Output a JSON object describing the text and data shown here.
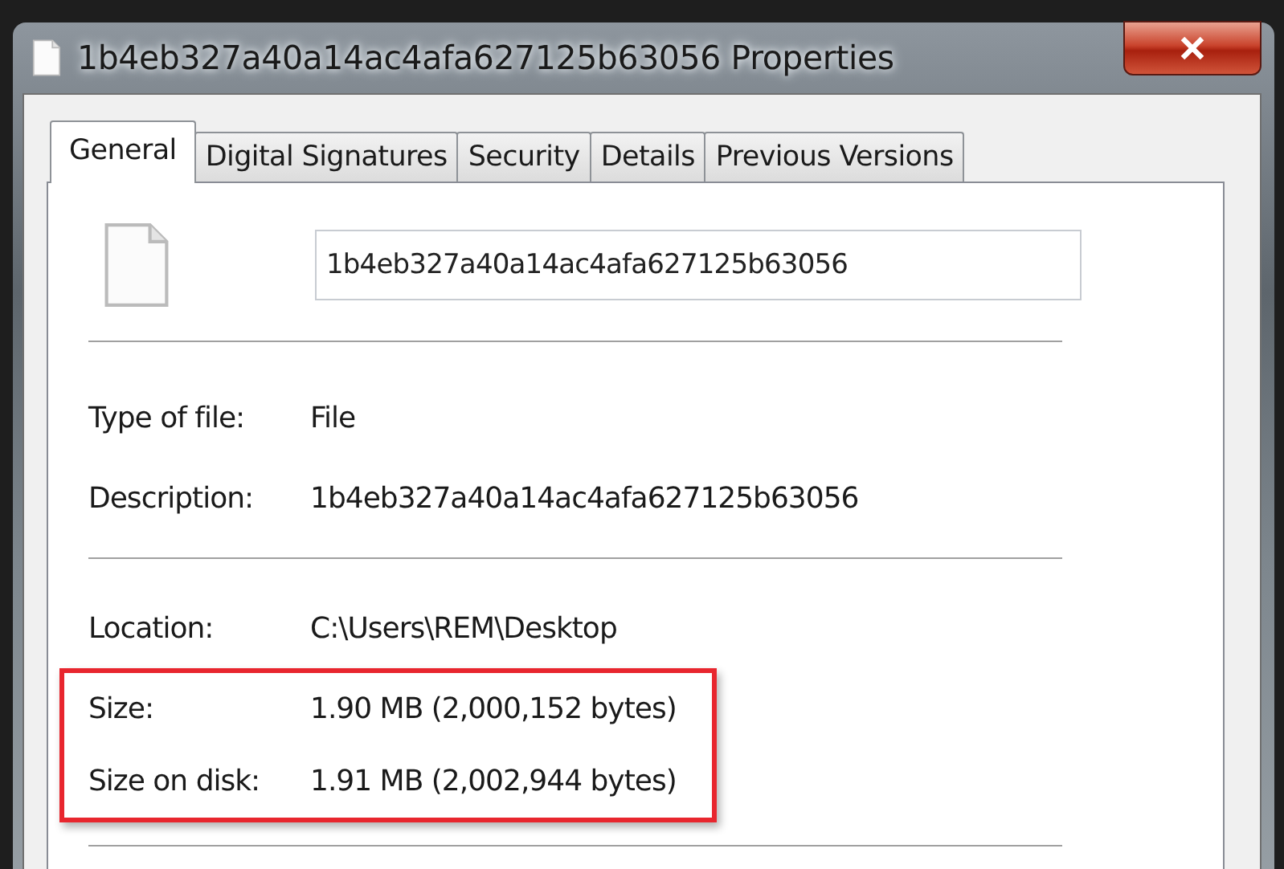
{
  "window": {
    "title": "1b4eb327a40a14ac4afa627125b63056 Properties"
  },
  "tabs": [
    {
      "label": "General",
      "selected": true
    },
    {
      "label": "Digital Signatures",
      "selected": false
    },
    {
      "label": "Security",
      "selected": false
    },
    {
      "label": "Details",
      "selected": false
    },
    {
      "label": "Previous Versions",
      "selected": false
    }
  ],
  "file_name": {
    "value": "1b4eb327a40a14ac4afa627125b63056"
  },
  "sections": [
    {
      "rows": [
        {
          "label": "Type of file:",
          "value": "File",
          "highlighted": false
        },
        {
          "label": "Description:",
          "value": "1b4eb327a40a14ac4afa627125b63056",
          "highlighted": false
        }
      ]
    },
    {
      "rows": [
        {
          "label": "Location:",
          "value": "C:\\Users\\REM\\Desktop",
          "highlighted": false
        },
        {
          "label": "Size:",
          "value": "1.90 MB (2,000,152 bytes)",
          "highlighted": true
        },
        {
          "label": "Size on disk:",
          "value": "1.91 MB (2,002,944 bytes)",
          "highlighted": true
        }
      ]
    }
  ]
}
